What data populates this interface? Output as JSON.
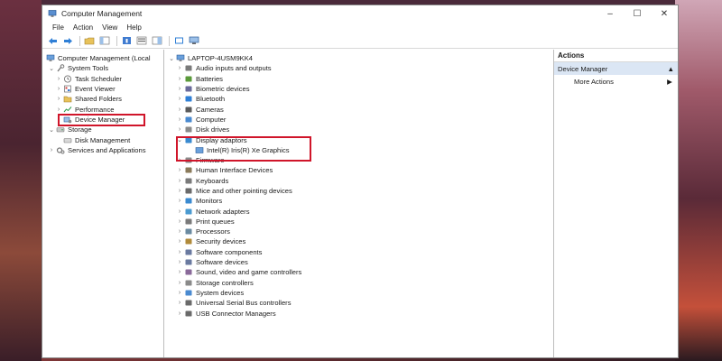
{
  "window": {
    "title": "Computer Management",
    "minimize": "–",
    "maximize": "☐",
    "close": "✕"
  },
  "menu": [
    "File",
    "Action",
    "View",
    "Help"
  ],
  "left_tree": {
    "root": "Computer Management (Local",
    "system_tools": "System Tools",
    "task_scheduler": "Task Scheduler",
    "event_viewer": "Event Viewer",
    "shared_folders": "Shared Folders",
    "performance": "Performance",
    "device_manager": "Device Manager",
    "storage": "Storage",
    "disk_management": "Disk Management",
    "services": "Services and Applications"
  },
  "device_tree": {
    "computer_name": "LAPTOP-4USM9KK4",
    "categories": [
      "Audio inputs and outputs",
      "Batteries",
      "Biometric devices",
      "Bluetooth",
      "Cameras",
      "Computer",
      "Disk drives",
      "Display adaptors",
      "Firmware",
      "Human Interface Devices",
      "Keyboards",
      "Mice and other pointing devices",
      "Monitors",
      "Network adapters",
      "Print queues",
      "Processors",
      "Security devices",
      "Software components",
      "Software devices",
      "Sound, video and game controllers",
      "Storage controllers",
      "System devices",
      "Universal Serial Bus controllers",
      "USB Connector Managers"
    ],
    "display_child": "Intel(R) Iris(R) Xe Graphics"
  },
  "actions": {
    "header": "Actions",
    "section": "Device Manager",
    "more": "More Actions"
  },
  "colors": {
    "highlight": "#d0152a",
    "selection_band": "#dbe6f4"
  }
}
